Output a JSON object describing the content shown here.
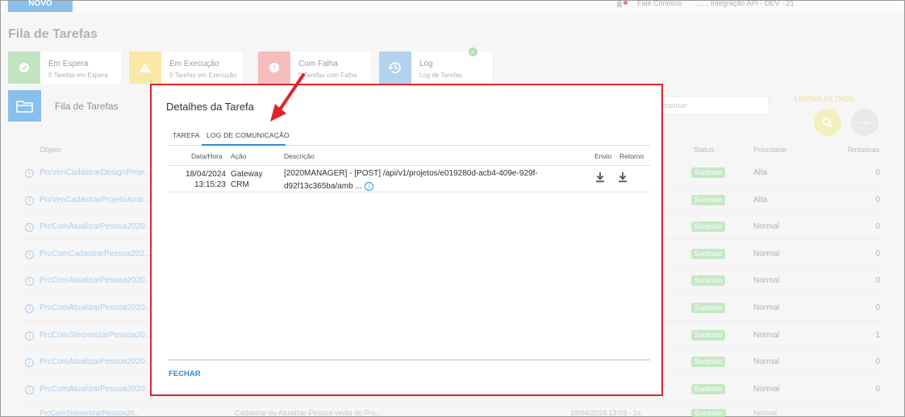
{
  "topbar": {
    "new_label": "NOVO",
    "contact": "Fale Conosco",
    "environment": "....... Integração API - DEV - 21"
  },
  "page": {
    "title": "Fila de Tarefas"
  },
  "cards": [
    {
      "title": "Em Espera",
      "subtitle": "0 Tarefas em Espera",
      "color": "#9fd79f",
      "icon": "check-icon"
    },
    {
      "title": "Em Execução",
      "subtitle": "0 Tarefas em Execução",
      "color": "#f7dc7a",
      "icon": "warning-icon"
    },
    {
      "title": "Com Falha",
      "subtitle": "0 Tarefas com Falha",
      "color": "#f19a9a",
      "icon": "error-icon"
    },
    {
      "title": "Log",
      "subtitle": "Log de Tarefas",
      "color": "#8dbbe6",
      "icon": "history-icon"
    }
  ],
  "list": {
    "title": "Fila de Tarefas",
    "search_placeholder": "esquisar",
    "clear_filters": "LIMPAR FILTROS",
    "columns": {
      "object": "Objeto",
      "status": "Status",
      "priority": "Prioridade",
      "attempts": "Tentativas"
    },
    "rows": [
      {
        "object": "PrcVenCadastrarDesignProje...",
        "status": "Sucesso",
        "priority": "Alta",
        "attempts": "0"
      },
      {
        "object": "PrcVenCadastrarProjetoAmb...",
        "status": "Sucesso",
        "priority": "Alta",
        "attempts": "0"
      },
      {
        "object": "PrcComAtualizarPessoa2020...",
        "status": "Sucesso",
        "priority": "Normal",
        "attempts": "0"
      },
      {
        "object": "PrcComCadastrarPessoa202...",
        "status": "Sucesso",
        "priority": "Normal",
        "attempts": "0"
      },
      {
        "object": "PrcComAtualizarPessoa2020...",
        "status": "Sucesso",
        "priority": "Normal",
        "attempts": "0"
      },
      {
        "object": "PrcComAtualizarPessoa2020...",
        "status": "Sucesso",
        "priority": "Normal",
        "attempts": "0"
      },
      {
        "object": "PrcComSincronizarPessoa20...",
        "status": "Sucesso",
        "priority": "Normal",
        "attempts": "1"
      },
      {
        "object": "PrcComAtualizarPessoa2020...",
        "status": "Sucesso",
        "priority": "Normal",
        "attempts": "0"
      },
      {
        "object": "PrcComAtualizarPessoa2020...",
        "status": "Sucesso",
        "priority": "Normal",
        "attempts": "0"
      }
    ],
    "cut_row": {
      "object": "PrcComSincronizarPessoa20...",
      "description": "Cadastrar ou Atualizar Pessoa vinda do Pro...",
      "date": "18/04/2024 13:03 - 1s",
      "status": "Sucesso",
      "priority": "Normal"
    }
  },
  "modal": {
    "title": "Detalhes da Tarefa",
    "tabs": [
      "TAREFA",
      "LOG DE COMUNICAÇÃO"
    ],
    "columns": {
      "datetime": "Data/Hora",
      "action": "Ação",
      "description": "Descrição",
      "sent": "Envio",
      "response": "Retorno"
    },
    "rows": [
      {
        "date": "18/04/2024",
        "time": "13:15:23",
        "action_line1": "Gateway",
        "action_line2": "CRM",
        "desc_line1": "[2020MANAGER] - [POST] /api/v1/projetos/e019280d-acb4-409e-929f-",
        "desc_line2": "d92f13c365ba/amb ..."
      }
    ],
    "close_label": "FECHAR"
  }
}
